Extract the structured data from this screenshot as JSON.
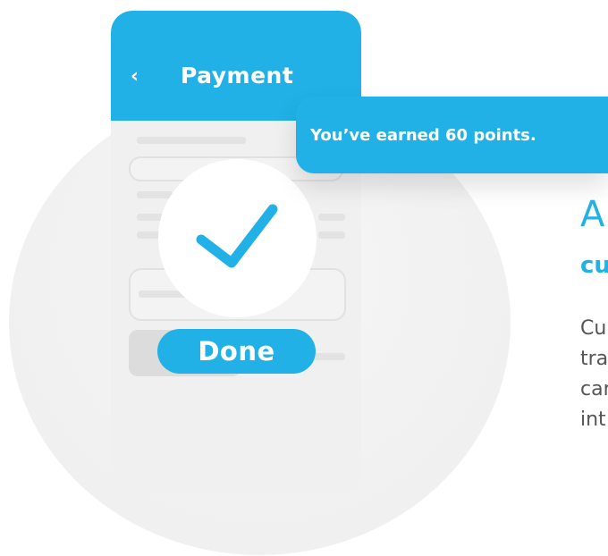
{
  "phone": {
    "header": {
      "back_icon": "chevron-left-icon",
      "back_glyph": "‹",
      "title": "Payment"
    },
    "checkmark_icon": "checkmark-icon",
    "done_label": "Done"
  },
  "toast": {
    "message": "You’ve earned 60 points."
  },
  "side_text": {
    "heading": "A",
    "subheading": "cu",
    "body_lines": [
      "Cu",
      "tra",
      "car",
      "int"
    ]
  },
  "colors": {
    "accent": "#21b1e6",
    "phone_bg": "#f0f0f0",
    "skeleton": "#e3e3e3",
    "body_text": "#555555"
  }
}
